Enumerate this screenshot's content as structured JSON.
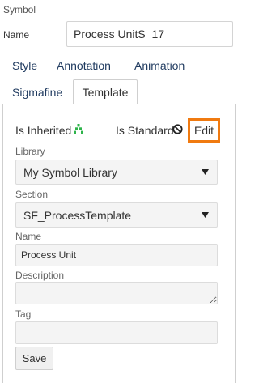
{
  "header": {
    "section_title": "Symbol",
    "name_label": "Name",
    "name_value": "Process UnitS_17"
  },
  "tabs": [
    {
      "label": "Style",
      "active": false
    },
    {
      "label": "Annotation",
      "active": false
    },
    {
      "label": "Animation",
      "active": false
    },
    {
      "label": "Sigmafine",
      "active": false
    },
    {
      "label": "Template",
      "active": true
    }
  ],
  "template": {
    "is_inherited_label": "Is Inherited",
    "is_standard_label": "Is Standard",
    "edit_label": "Edit",
    "library_label": "Library",
    "library_value": "My Symbol Library",
    "section_label": "Section",
    "section_value": "SF_ProcessTemplate",
    "name_label": "Name",
    "name_value": "Process Unit",
    "description_label": "Description",
    "description_value": "",
    "tag_label": "Tag",
    "tag_value": "",
    "save_label": "Save"
  },
  "icons": {
    "inherit": "hierarchy-icon",
    "standard": "ban-icon",
    "dropdown": "caret-down-icon"
  },
  "colors": {
    "accent_highlight": "#f07a10",
    "inherit_icon": "#2db34a",
    "tab_text": "#1f3a5f"
  }
}
